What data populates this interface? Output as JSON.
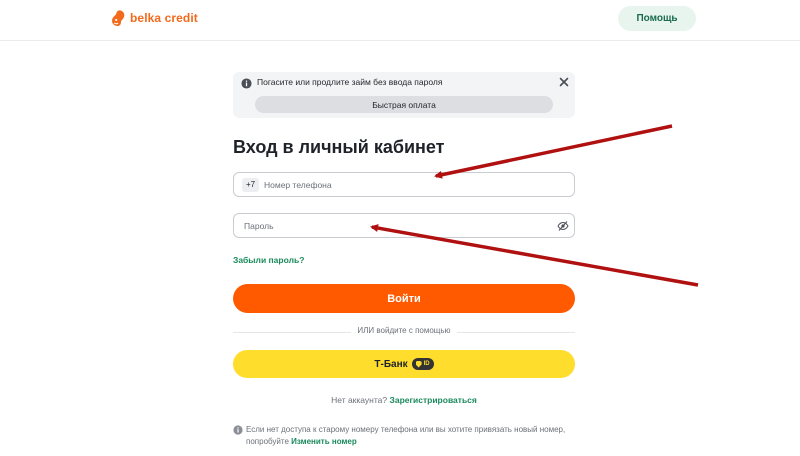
{
  "header": {
    "logo_text": "belka credit",
    "help_label": "Помощь"
  },
  "banner": {
    "text": "Погасите или продлите займ без ввода пароля",
    "button_label": "Быстрая оплата"
  },
  "login": {
    "title": "Вход в личный кабинет",
    "phone_prefix": "+7",
    "phone_placeholder": "Номер телефона",
    "password_placeholder": "Пароль",
    "forgot_label": "Забыли пароль?",
    "submit_label": "Войти",
    "divider_text": "ИЛИ войдите с помощью",
    "tbank_label": "Т-Банк",
    "tbank_badge": "ID",
    "no_account_text": "Нет аккаунта?",
    "register_label": "Зарегистрироваться",
    "note_text": "Если нет доступа к старому номеру телефона или вы хотите привязать новый номер, попробуйте",
    "change_number_label": "Изменить номер"
  },
  "colors": {
    "brand_orange": "#ff5a00",
    "tbank_yellow": "#ffdd2d",
    "link_green": "#1a8a5c",
    "annotation_red": "#b01010"
  },
  "icons": {
    "banner": "info-icon",
    "close": "close-icon",
    "password": "eye-slash-icon",
    "note": "info-icon",
    "logo": "squirrel-logo-icon"
  }
}
